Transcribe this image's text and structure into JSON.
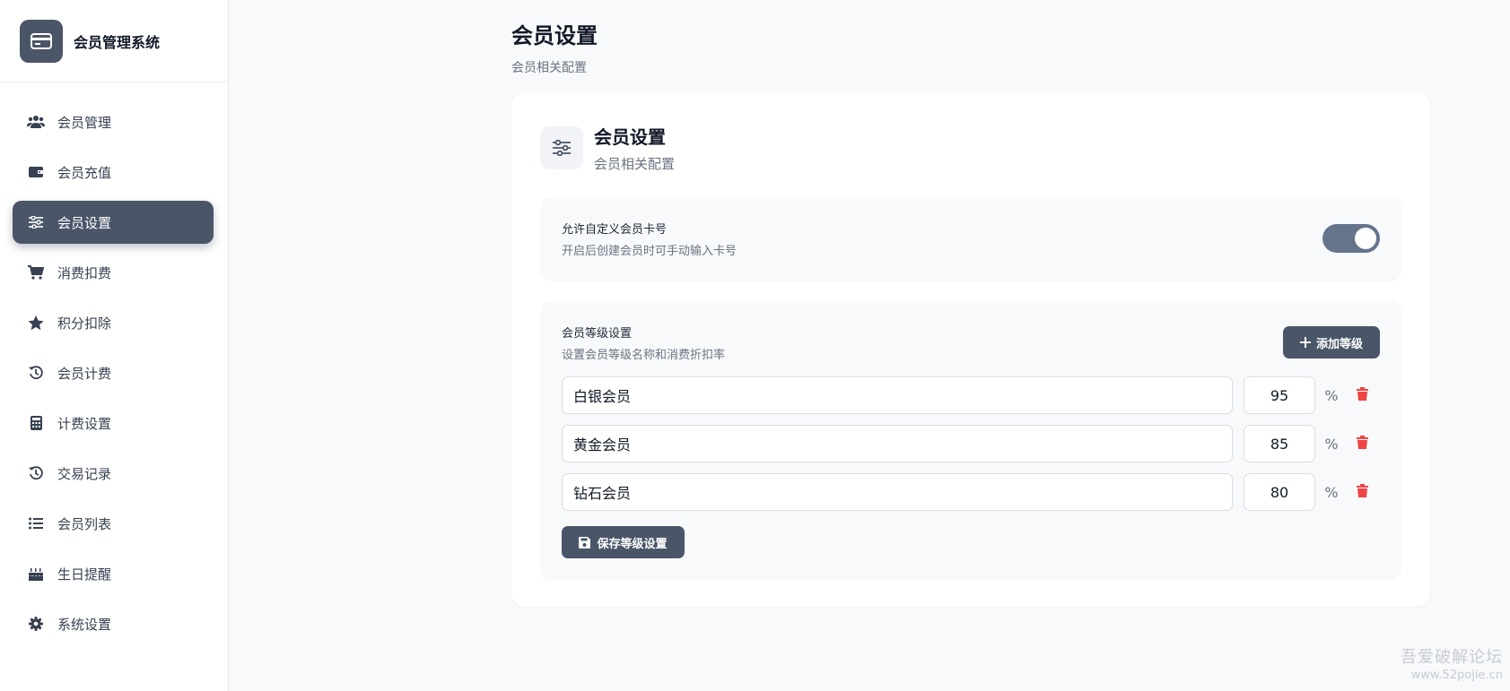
{
  "app": {
    "title": "会员管理系统"
  },
  "sidebar": {
    "items": [
      {
        "label": "会员管理",
        "icon": "users-icon"
      },
      {
        "label": "会员充值",
        "icon": "wallet-icon"
      },
      {
        "label": "会员设置",
        "icon": "sliders-icon",
        "active": true
      },
      {
        "label": "消费扣费",
        "icon": "cart-icon"
      },
      {
        "label": "积分扣除",
        "icon": "star-icon"
      },
      {
        "label": "会员计费",
        "icon": "history-icon"
      },
      {
        "label": "计费设置",
        "icon": "calculator-icon"
      },
      {
        "label": "交易记录",
        "icon": "history-icon"
      },
      {
        "label": "会员列表",
        "icon": "list-icon"
      },
      {
        "label": "生日提醒",
        "icon": "cake-icon"
      },
      {
        "label": "系统设置",
        "icon": "gear-icon"
      }
    ]
  },
  "page": {
    "title": "会员设置",
    "subtitle": "会员相关配置"
  },
  "card": {
    "title": "会员设置",
    "subtitle": "会员相关配置"
  },
  "custom_card": {
    "label": "允许自定义会员卡号",
    "desc": "开启后创建会员时可手动输入卡号",
    "enabled": true
  },
  "levels": {
    "label": "会员等级设置",
    "desc": "设置会员等级名称和消费折扣率",
    "add_label": "添加等级",
    "save_label": "保存等级设置",
    "unit": "%",
    "rows": [
      {
        "name": "白银会员",
        "rate": "95"
      },
      {
        "name": "黄金会员",
        "rate": "85"
      },
      {
        "name": "钻石会员",
        "rate": "80"
      }
    ]
  },
  "watermark": {
    "line1": "吾爱破解论坛",
    "line2": "www.52pojie.cn"
  },
  "colors": {
    "accent": "#4a5568",
    "toggle_on": "#64748b",
    "danger": "#ef4444"
  }
}
